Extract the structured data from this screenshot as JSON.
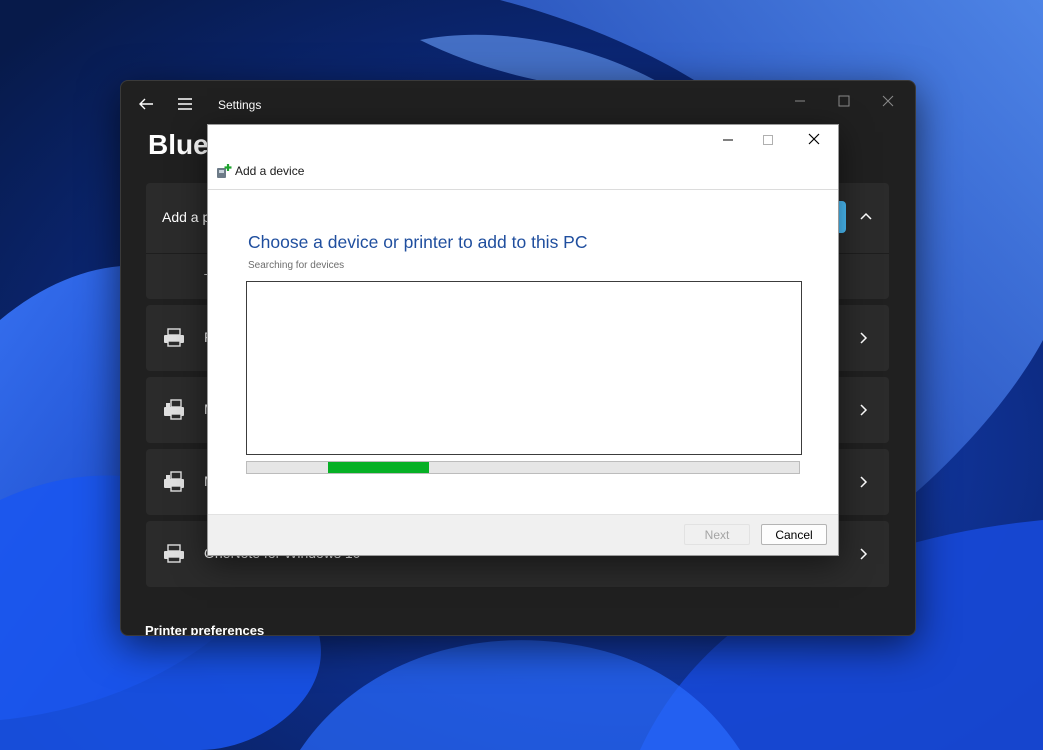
{
  "settings": {
    "app_title": "Settings",
    "page_title": "Bluet",
    "add_card": {
      "label": "Add a p",
      "sub_start": "T",
      "sub_end": "y"
    },
    "printers": [
      {
        "label": "F",
        "icon": "printer-icon"
      },
      {
        "label": "M",
        "icon": "fax-printer-icon"
      },
      {
        "label": "M",
        "icon": "fax-printer-icon"
      },
      {
        "label": "OneNote for Windows 10",
        "icon": "printer-icon"
      }
    ],
    "section_header": "Printer preferences"
  },
  "dialog": {
    "title": "Add a device",
    "heading": "Choose a device or printer to add to this PC",
    "status": "Searching for devices",
    "progress": {
      "start": 0.147,
      "end": 0.33,
      "color": "#06b025"
    },
    "buttons": {
      "next": "Next",
      "cancel": "Cancel"
    }
  },
  "colors": {
    "accent": "#4cc2ff",
    "heading_blue": "#1f4e9e",
    "settings_bg": "#202020",
    "card_bg": "#2b2b2b"
  }
}
